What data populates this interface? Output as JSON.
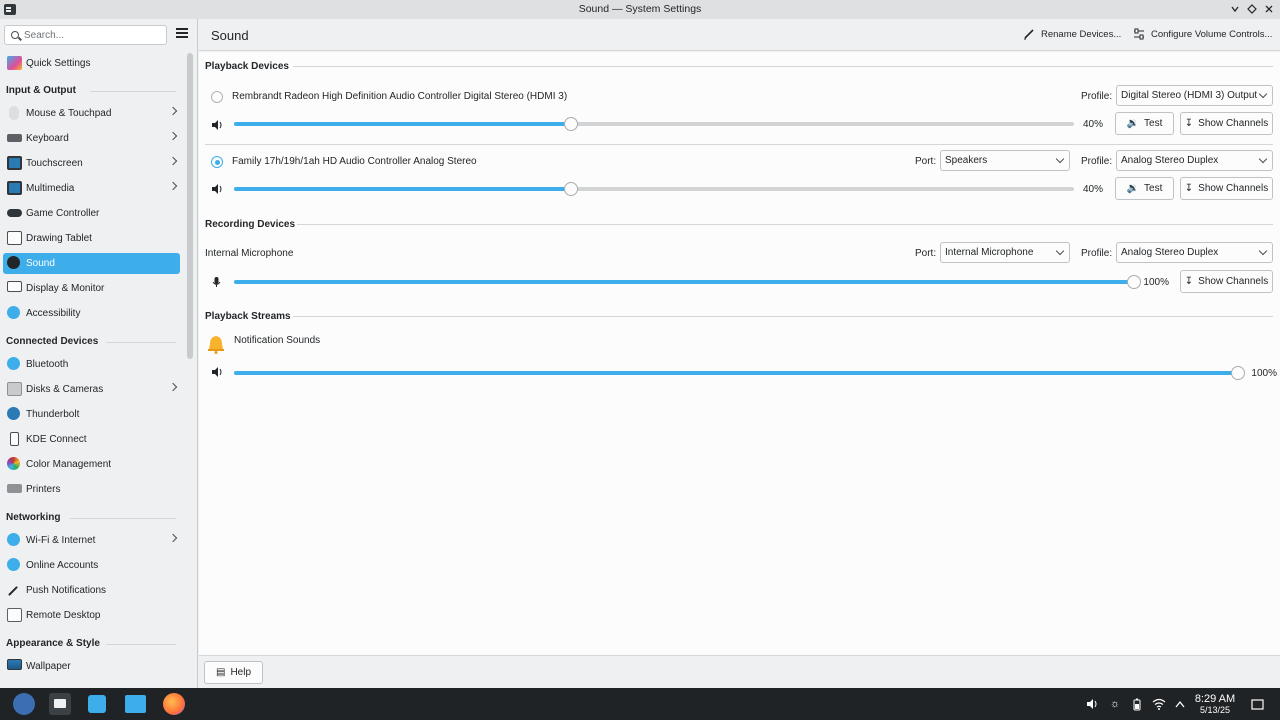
{
  "window": {
    "title": "Sound — System Settings",
    "controls": [
      "chevron-down",
      "diamond",
      "close"
    ]
  },
  "sidebar": {
    "search_placeholder": "Search...",
    "quick_settings": "Quick Settings",
    "categories": [
      {
        "label": "Input & Output"
      },
      {
        "label": "Connected Devices"
      },
      {
        "label": "Networking"
      },
      {
        "label": "Appearance & Style"
      }
    ],
    "items": [
      {
        "label": "Mouse & Touchpad",
        "icon": "mouse-icon",
        "color": "#c8cbce",
        "has_children": true
      },
      {
        "label": "Keyboard",
        "icon": "keyboard-icon",
        "color": "#5d6165",
        "has_children": true
      },
      {
        "label": "Touchscreen",
        "icon": "touchscreen-icon",
        "color": "#2a7ab5",
        "has_children": true
      },
      {
        "label": "Multimedia",
        "icon": "multimedia-icon",
        "color": "#2a7ab5",
        "has_children": true
      },
      {
        "label": "Game Controller",
        "icon": "gamepad-icon",
        "color": "#31363b",
        "has_children": false
      },
      {
        "label": "Drawing Tablet",
        "icon": "tablet-icon",
        "color": "#4d4d4d",
        "has_children": false
      },
      {
        "label": "Sound",
        "icon": "speaker-icon",
        "color": "#232629",
        "has_children": false,
        "selected": true
      },
      {
        "label": "Display & Monitor",
        "icon": "monitor-icon",
        "color": "#4d4d4d",
        "has_children": false
      },
      {
        "label": "Accessibility",
        "icon": "accessibility-icon",
        "color": "#3daee9",
        "has_children": false
      },
      {
        "label": "Bluetooth",
        "icon": "bluetooth-icon",
        "color": "#3daee9",
        "has_children": false
      },
      {
        "label": "Disks & Cameras",
        "icon": "disk-icon",
        "color": "#8e9196",
        "has_children": true
      },
      {
        "label": "Thunderbolt",
        "icon": "thunderbolt-icon",
        "color": "#2a7ab5",
        "has_children": false
      },
      {
        "label": "KDE Connect",
        "icon": "phone-icon",
        "color": "#4d4d4d",
        "has_children": false
      },
      {
        "label": "Color Management",
        "icon": "color-icon",
        "color": "#c0392b",
        "has_children": false
      },
      {
        "label": "Printers",
        "icon": "printer-icon",
        "color": "#6e7277",
        "has_children": false
      },
      {
        "label": "Wi-Fi & Internet",
        "icon": "globe-icon",
        "color": "#3daee9",
        "has_children": true
      },
      {
        "label": "Online Accounts",
        "icon": "accounts-icon",
        "color": "#3daee9",
        "has_children": false
      },
      {
        "label": "Push Notifications",
        "icon": "pin-icon",
        "color": "#232629",
        "has_children": false
      },
      {
        "label": "Remote Desktop",
        "icon": "remote-desktop-icon",
        "color": "#5d6165",
        "has_children": false
      },
      {
        "label": "Wallpaper",
        "icon": "wallpaper-icon",
        "color": "#2a7ab5",
        "has_children": false
      }
    ]
  },
  "header": {
    "page_title": "Sound",
    "rename_label": "Rename Devices...",
    "configure_label": "Configure Volume Controls..."
  },
  "playback": {
    "title": "Playback Devices",
    "devices": [
      {
        "name": "Rembrandt Radeon High Definition Audio Controller Digital Stereo (HDMI 3)",
        "default": false,
        "profile_label": "Profile:",
        "profile": "Digital Stereo (HDMI 3) Output",
        "volume": 40,
        "volume_text": "40%",
        "test_label": "Test",
        "channels_label": "Show Channels"
      },
      {
        "name": "Family 17h/19h/1ah HD Audio Controller Analog Stereo",
        "default": true,
        "port_label": "Port:",
        "port": "Speakers",
        "profile_label": "Profile:",
        "profile": "Analog Stereo Duplex",
        "volume": 40,
        "volume_text": "40%",
        "test_label": "Test",
        "channels_label": "Show Channels"
      }
    ]
  },
  "recording": {
    "title": "Recording Devices",
    "device": {
      "name": "Internal Microphone",
      "port_label": "Port:",
      "port": "Internal Microphone",
      "profile_label": "Profile:",
      "profile": "Analog Stereo Duplex",
      "volume": 100,
      "volume_text": "100%",
      "channels_label": "Show Channels"
    }
  },
  "streams": {
    "title": "Playback Streams",
    "stream": {
      "name": "Notification Sounds",
      "volume": 100,
      "volume_text": "100%"
    }
  },
  "footer": {
    "help_label": "Help"
  },
  "taskbar": {
    "time": "8:29 AM",
    "date": "5/13/25"
  },
  "colors": {
    "accent": "#3daee9",
    "taskbar": "#202326",
    "window_bg": "#eff0f1",
    "content_bg": "#fcfcfc"
  }
}
